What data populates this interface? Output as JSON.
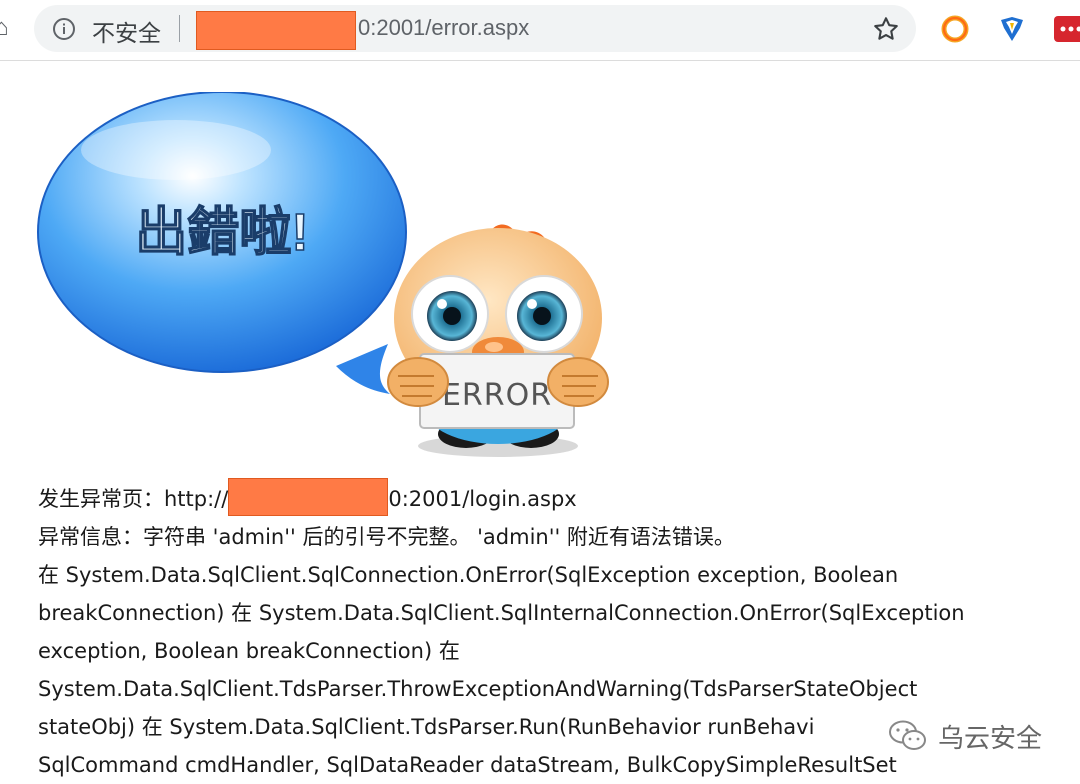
{
  "toolbar": {
    "security_label": "不安全",
    "url_suffix": "0:2001/error.aspx"
  },
  "illustration": {
    "bubble_text": "出錯啦!",
    "sign_text": "ERROR"
  },
  "error": {
    "page_label": "发生异常页：http://",
    "page_url_suffix": "0:2001/login.aspx",
    "message": "异常信息：字符串 'admin'' 后的引号不完整。 'admin'' 附近有语法错误。",
    "stack_lines": [
      "在 System.Data.SqlClient.SqlConnection.OnError(SqlException exception, Boolean",
      "breakConnection) 在 System.Data.SqlClient.SqlInternalConnection.OnError(SqlException",
      "exception, Boolean breakConnection) 在",
      "System.Data.SqlClient.TdsParser.ThrowExceptionAndWarning(TdsParserStateObject",
      "stateObj) 在 System.Data.SqlClient.TdsParser.Run(RunBehavior runBehavi",
      "SqlCommand cmdHandler, SqlDataReader dataStream, BulkCopySimpleResultSet"
    ]
  },
  "watermark": {
    "text": "乌云安全",
    "icon": "wechat-icon"
  },
  "colors": {
    "redaction": "#ff7a45",
    "bubble": "#3a8ff0",
    "mascot_hair": "#f26b21"
  }
}
